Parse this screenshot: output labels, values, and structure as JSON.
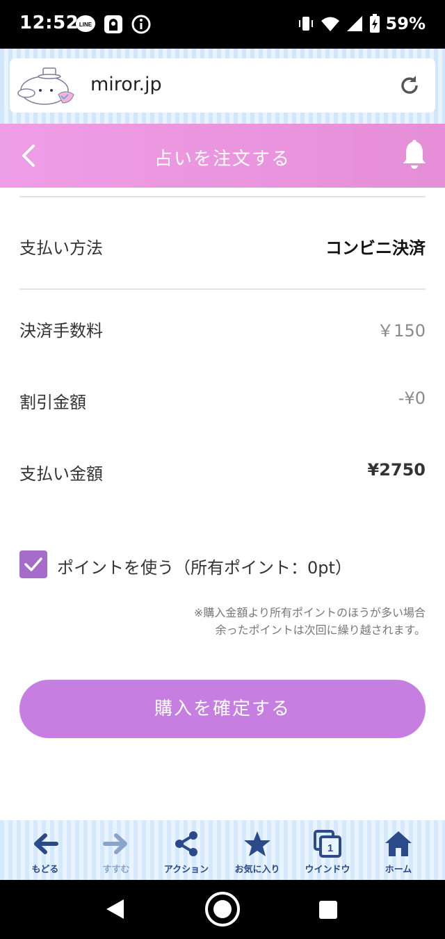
{
  "status_bar": {
    "time": "12:52",
    "battery": "59%",
    "icons_left": [
      "line-icon",
      "app-notification-icon",
      "info-icon"
    ],
    "icons_right": [
      "vibrate-icon",
      "wifi-icon",
      "signal-icon",
      "battery-charging-icon"
    ]
  },
  "browser": {
    "url": "miror.jp"
  },
  "header": {
    "title": "占いを注文する"
  },
  "order": {
    "payment_method_label": "支払い方法",
    "payment_method_value": "コンビニ決済",
    "fee_label": "決済手数料",
    "fee_value": "￥150",
    "discount_label": "割引金額",
    "discount_value": "-¥0",
    "total_label": "支払い金額",
    "total_value": "¥2750"
  },
  "points": {
    "checkbox_label": "ポイントを使う（所有ポイント：0pt）",
    "checked": true,
    "note_line1": "※購入金額より所有ポイントのほうが多い場合",
    "note_line2": "余ったポイントは次回に繰り越されます。"
  },
  "purchase_button": "購入を確定する",
  "toolbar": {
    "back": "もどる",
    "forward": "すすむ",
    "action": "アクション",
    "favorites": "お気に入り",
    "window": "ウインドウ",
    "window_count": "1",
    "home": "ホーム"
  },
  "colors": {
    "header_pink": "#e68ed8",
    "button_purple": "#c67fe1",
    "checkbox_purple": "#a56cc9",
    "toolbar_blue": "#2b4a8a"
  }
}
